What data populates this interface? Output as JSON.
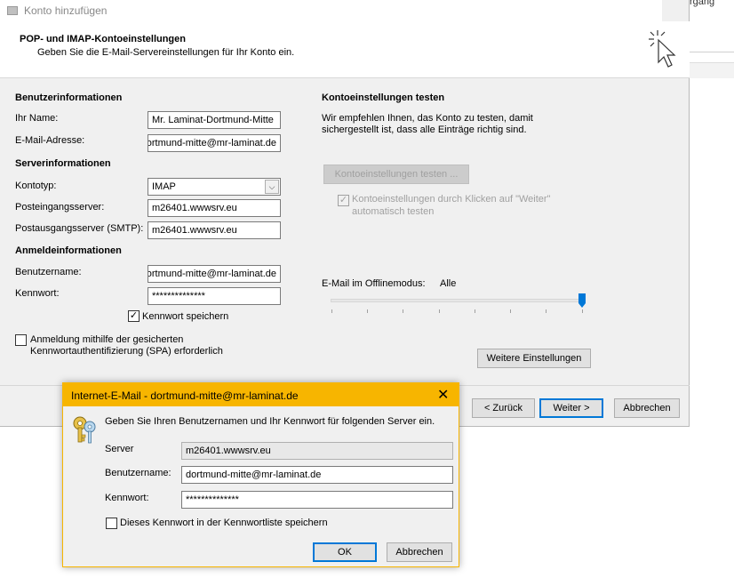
{
  "background": {
    "partial_text": "rgang",
    "close_glyph": "✕"
  },
  "window": {
    "title": "Konto hinzufügen",
    "header_title": "POP- und IMAP-Kontoeinstellungen",
    "header_subtitle": "Geben Sie die E-Mail-Servereinstellungen für Ihr Konto ein."
  },
  "left": {
    "user_info_heading": "Benutzerinformationen",
    "name_label": "Ihr Name:",
    "name_value": "Mr. Laminat-Dortmund-Mitte",
    "email_label": "E-Mail-Adresse:",
    "email_value": "dortmund-mitte@mr-laminat.de",
    "server_info_heading": "Serverinformationen",
    "account_type_label": "Kontotyp:",
    "account_type_value": "IMAP",
    "incoming_label": "Posteingangsserver:",
    "incoming_value": "m26401.wwwsrv.eu",
    "outgoing_label": "Postausgangsserver (SMTP):",
    "outgoing_value": "m26401.wwwsrv.eu",
    "logon_heading": "Anmeldeinformationen",
    "username_label": "Benutzername:",
    "username_value": "dortmund-mitte@mr-laminat.de",
    "password_label": "Kennwort:",
    "password_value": "**************",
    "remember_password_label": "Kennwort speichern",
    "remember_password_checked": true,
    "spa_label_line1": "Anmeldung mithilfe der gesicherten",
    "spa_label_line2": "Kennwortauthentifizierung (SPA) erforderlich",
    "spa_checked": false
  },
  "right": {
    "test_heading": "Kontoeinstellungen testen",
    "test_desc_line1": "Wir empfehlen Ihnen, das Konto zu testen, damit",
    "test_desc_line2": "sichergestellt ist, dass alle Einträge richtig sind.",
    "test_button": "Kontoeinstellungen testen ...",
    "auto_test_line1": "Kontoeinstellungen durch Klicken auf \"Weiter\"",
    "auto_test_line2": "automatisch testen",
    "auto_test_checked": true,
    "offline_label": "E-Mail im Offlinemodus:",
    "offline_value": "Alle",
    "offline_slider_position": 1.0,
    "more_settings_button": "Weitere Einstellungen"
  },
  "footer": {
    "back_button": "< Zurück",
    "next_button": "Weiter >",
    "cancel_button": "Abbrechen"
  },
  "popup": {
    "title": "Internet-E-Mail - dortmund-mitte@mr-laminat.de",
    "close_glyph": "✕",
    "message": "Geben Sie Ihren Benutzernamen und Ihr Kennwort für folgenden Server ein.",
    "server_label": "Server",
    "server_value": "m26401.wwwsrv.eu",
    "username_label": "Benutzername:",
    "username_value": "dortmund-mitte@mr-laminat.de",
    "password_label": "Kennwort:",
    "password_value": "**************",
    "save_password_label": "Dieses Kennwort in der Kennwortliste speichern",
    "save_password_checked": false,
    "ok_button": "OK",
    "cancel_button": "Abbrechen"
  },
  "colors": {
    "popup_accent": "#f7b500",
    "close_red": "#e81123",
    "primary_border": "#0078d7",
    "slider_thumb": "#0078d7"
  },
  "icons": {
    "cursor": "mouse-cursor-icon",
    "keys": "keys-icon",
    "dropdown": "chevron-down-icon",
    "check": "checkmark-icon"
  }
}
